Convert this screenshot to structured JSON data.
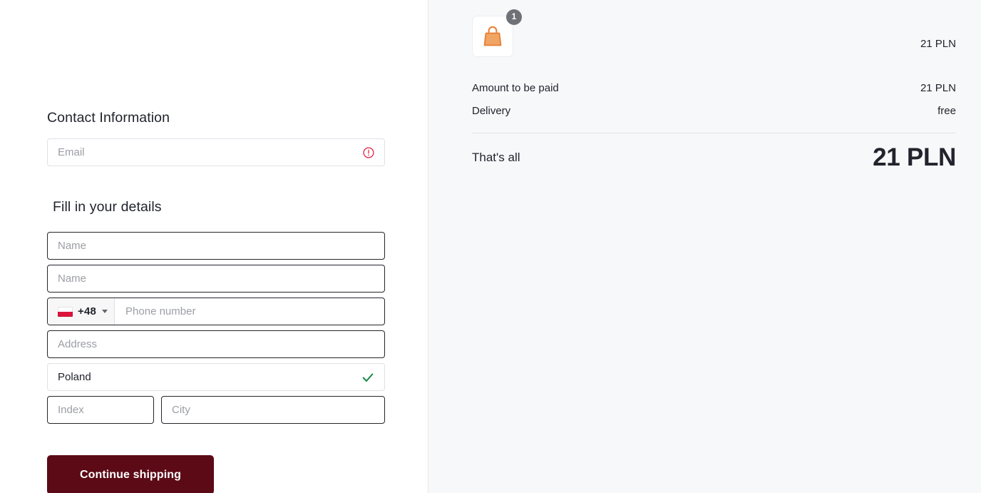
{
  "checkout": {
    "contact": {
      "title": "Contact Information",
      "email_placeholder": "Email",
      "email_value": "",
      "email_status_icon": "error-circle-icon"
    },
    "details": {
      "title": "Fill in your details",
      "first_name_placeholder": "Name",
      "first_name_value": "",
      "last_name_placeholder": "Name",
      "last_name_value": "",
      "phone": {
        "flag_icon": "flag-poland-icon",
        "dial_code": "+48",
        "caret_icon": "chevron-down-icon",
        "placeholder": "Phone number",
        "value": ""
      },
      "address_placeholder": "Address",
      "address_value": "",
      "country_value": "Poland",
      "country_status_icon": "check-icon",
      "index_placeholder": "Index",
      "index_value": "",
      "city_placeholder": "City",
      "city_value": ""
    },
    "submit_label": "Continue shipping"
  },
  "summary": {
    "cart": {
      "item_icon": "shopping-bag-icon",
      "quantity_badge": "1",
      "item_price": "21 PLN"
    },
    "lines": [
      {
        "label": "Amount to be paid",
        "value": "21 PLN"
      },
      {
        "label": "Delivery",
        "value": "free"
      }
    ],
    "total_label": "That's all",
    "total_value": "21 PLN"
  },
  "colors": {
    "accent_button": "#5c0a16",
    "error": "#e02443",
    "success": "#1a8a4c",
    "badge": "#6e7176",
    "panel_bg": "#f7f8fa"
  }
}
